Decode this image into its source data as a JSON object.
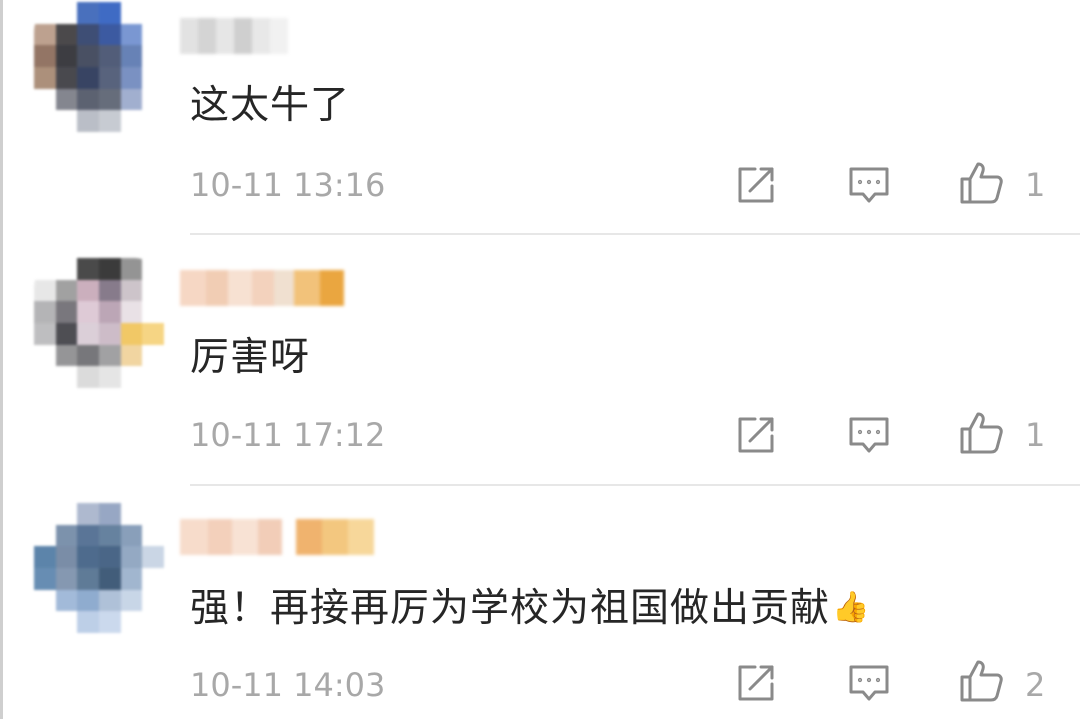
{
  "comments": [
    {
      "avatar_colors": [
        "#ffffff",
        "#ffffff",
        "#3a64b8",
        "#2f5fc0",
        "#ffffff",
        "#ffffff",
        "#b89a86",
        "#3c3a3c",
        "#2e3f6a",
        "#2c4d9a",
        "#6f8fcf",
        "#ffffff",
        "#8a6a58",
        "#2d2d33",
        "#3a4256",
        "#44506e",
        "#5b78b0",
        "#ffffff",
        "#a58770",
        "#3a3a40",
        "#283556",
        "#4a5672",
        "#6f88bd",
        "#ffffff",
        "#ffffff",
        "#7a7c86",
        "#4f5566",
        "#5a6170",
        "#9aa9cc",
        "#ffffff",
        "#ffffff",
        "#ffffff",
        "#b5b9c3",
        "#c3c7cf",
        "#ffffff",
        "#ffffff"
      ],
      "username_colors": [
        "#e2e2e2",
        "#d4d4d4",
        "#e6e6e6",
        "#cfcfcf",
        "#e8e8e8",
        "#f1f1f1"
      ],
      "text": "这太牛了",
      "time": "10-11 13:16",
      "likes": "1"
    },
    {
      "avatar_colors": [
        "#ffffff",
        "#ffffff",
        "#3b3b3b",
        "#2b2b2b",
        "#8c8c8c",
        "#ffffff",
        "#e6e6e6",
        "#9a9a9a",
        "#c7a9b8",
        "#7d7082",
        "#c9c0c6",
        "#ffffff",
        "#aeaeb0",
        "#6e6c72",
        "#dcc6d3",
        "#b79fb0",
        "#e8dfe4",
        "#ffffff",
        "#b9b9bb",
        "#3f3f45",
        "#d8cbd5",
        "#c9b7c4",
        "#f0c45a",
        "#f6d27a",
        "#ffffff",
        "#8d8d8f",
        "#6c6c70",
        "#9a9a9c",
        "#f0d29a",
        "#ffffff",
        "#ffffff",
        "#ffffff",
        "#d9d9d9",
        "#e3e3e3",
        "#ffffff",
        "#ffffff"
      ],
      "username_colors": [
        "#f6d7c4",
        "#f1cdb4",
        "#f7e1d2",
        "#f3d2bd",
        "#f0e0d0",
        "#f2c27a",
        "#eaa640"
      ],
      "text": "厉害呀",
      "time": "10-11 17:12",
      "likes": "1"
    },
    {
      "avatar_colors": [
        "#ffffff",
        "#ffffff",
        "#a8b4cc",
        "#8fa0bf",
        "#ffffff",
        "#ffffff",
        "#ffffff",
        "#7189a6",
        "#4d6a8f",
        "#5a7897",
        "#7f97b5",
        "#ffffff",
        "#4f7aa3",
        "#6f84a0",
        "#3f5f84",
        "#3b5a7d",
        "#8ba2be",
        "#c6d3e3",
        "#5b84ad",
        "#7b90ab",
        "#52708f",
        "#33506f",
        "#9ab0cb",
        "#ffffff",
        "#ffffff",
        "#9bb5d6",
        "#86a5cb",
        "#a9bcd5",
        "#c4d3e6",
        "#ffffff",
        "#ffffff",
        "#ffffff",
        "#b8cbe6",
        "#c7d6ec",
        "#ffffff",
        "#ffffff"
      ],
      "username_colors": [
        "#f7dccb",
        "#f3d0bb",
        "#f8e2d4",
        "#f2cdb8",
        "#ffffff",
        "#f0b36e",
        "#f3c77f",
        "#f7d79a"
      ],
      "text": "强！再接再厉为学校为祖国做出贡献",
      "emoji": "👍",
      "time": "10-11 14:03",
      "likes": "2"
    }
  ],
  "icons": {
    "share": "share-icon",
    "reply": "comment-icon",
    "like": "thumbs-up-icon"
  },
  "colors": {
    "text": "#262626",
    "meta": "#a8a8a8",
    "icon": "#8a8a8a",
    "divider": "#e7e7e7"
  }
}
